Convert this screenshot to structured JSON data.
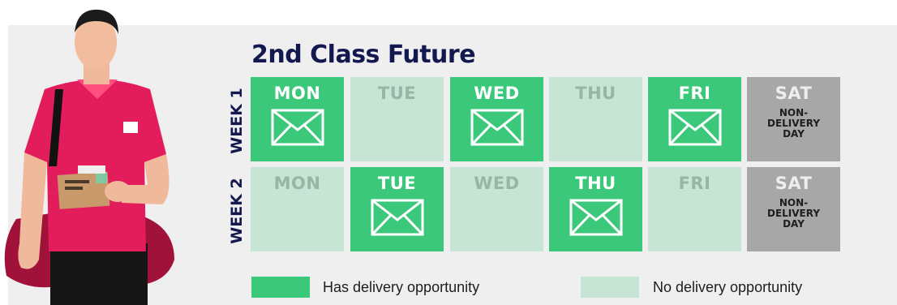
{
  "title": "2nd Class Future",
  "weeks": [
    {
      "label": "WEEK 1",
      "days": [
        {
          "day": "MON",
          "status": "delivery"
        },
        {
          "day": "TUE",
          "status": "none"
        },
        {
          "day": "WED",
          "status": "delivery"
        },
        {
          "day": "THU",
          "status": "none"
        },
        {
          "day": "FRI",
          "status": "delivery"
        },
        {
          "day": "SAT",
          "status": "non-delivery",
          "note": "NON-DELIVERY DAY"
        }
      ]
    },
    {
      "label": "WEEK 2",
      "days": [
        {
          "day": "MON",
          "status": "none"
        },
        {
          "day": "TUE",
          "status": "delivery"
        },
        {
          "day": "WED",
          "status": "none"
        },
        {
          "day": "THU",
          "status": "delivery"
        },
        {
          "day": "FRI",
          "status": "none"
        },
        {
          "day": "SAT",
          "status": "non-delivery",
          "note": "NON-DELIVERY DAY"
        }
      ]
    }
  ],
  "legend": {
    "has_delivery": "Has delivery opportunity",
    "no_delivery": "No delivery opportunity"
  },
  "colors": {
    "delivery": "#3cc87a",
    "no_delivery": "#c6e5d4",
    "non_delivery_day": "#a7a7a7",
    "title": "#13184f"
  }
}
